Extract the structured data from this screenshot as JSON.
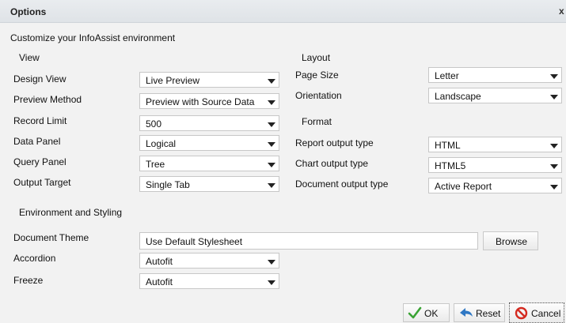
{
  "dialog": {
    "title": "Options",
    "close_glyph": "x",
    "heading": "Customize your InfoAssist environment"
  },
  "view": {
    "section_label": "View",
    "design_view": {
      "label": "Design View",
      "value": "Live Preview"
    },
    "preview_method": {
      "label": "Preview Method",
      "value": "Preview with Source Data"
    },
    "record_limit": {
      "label": "Record Limit",
      "value": "500"
    },
    "data_panel": {
      "label": "Data Panel",
      "value": "Logical"
    },
    "query_panel": {
      "label": "Query Panel",
      "value": "Tree"
    },
    "output_target": {
      "label": "Output Target",
      "value": "Single Tab"
    }
  },
  "layout": {
    "section_label": "Layout",
    "page_size": {
      "label": "Page Size",
      "value": "Letter"
    },
    "orientation": {
      "label": "Orientation",
      "value": "Landscape"
    }
  },
  "format": {
    "section_label": "Format",
    "report_output": {
      "label": "Report output type",
      "value": "HTML"
    },
    "chart_output": {
      "label": "Chart output type",
      "value": "HTML5"
    },
    "document_output": {
      "label": "Document output type",
      "value": "Active Report"
    }
  },
  "environment": {
    "section_label": "Environment and Styling",
    "document_theme": {
      "label": "Document Theme",
      "value": "Use Default Stylesheet",
      "browse_label": "Browse"
    },
    "accordion": {
      "label": "Accordion",
      "value": "Autofit"
    },
    "freeze": {
      "label": "Freeze",
      "value": "Autofit"
    }
  },
  "footer": {
    "ok_label": "OK",
    "reset_label": "Reset",
    "cancel_label": "Cancel"
  },
  "icons": {
    "ok": "checkmark-icon",
    "reset": "reset-arrow-icon",
    "cancel": "cancel-icon"
  },
  "colors": {
    "ok_check": "#3aa335",
    "reset_arrow": "#2f78c4",
    "cancel_red": "#d42a20"
  }
}
